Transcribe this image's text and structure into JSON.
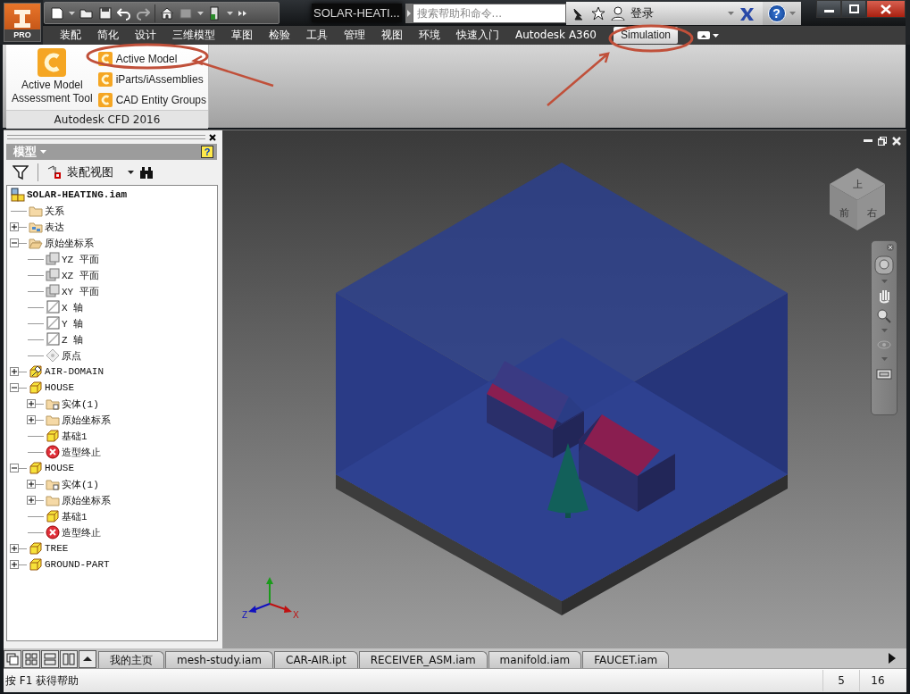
{
  "window": {
    "title": "SOLAR-HEATI...",
    "app_badge": "PRO"
  },
  "search": {
    "placeholder": "搜索帮助和命令..."
  },
  "account": {
    "sign_in": "登录",
    "help_label": "?"
  },
  "ribbon_tabs": [
    {
      "label": "装配",
      "selected": false
    },
    {
      "label": "简化",
      "selected": false
    },
    {
      "label": "设计",
      "selected": false
    },
    {
      "label": "三维模型",
      "selected": false
    },
    {
      "label": "草图",
      "selected": false
    },
    {
      "label": "检验",
      "selected": false
    },
    {
      "label": "工具",
      "selected": false
    },
    {
      "label": "管理",
      "selected": false
    },
    {
      "label": "视图",
      "selected": false
    },
    {
      "label": "环境",
      "selected": false
    },
    {
      "label": "快速入门",
      "selected": false
    },
    {
      "label": "Autodesk A360",
      "selected": false
    },
    {
      "label": "Simulation",
      "selected": true
    }
  ],
  "ribbon_panel": {
    "title": "Autodesk CFD 2016",
    "large_button": "Active Model Assessment Tool",
    "small_buttons": [
      "Active Model",
      "iParts/iAssemblies",
      "CAD Entity Groups"
    ]
  },
  "browser": {
    "title": "模型",
    "help_label": "?",
    "view_label": "装配视图",
    "tree": [
      {
        "label": "SOLAR-HEATING.iam",
        "kind": "assembly",
        "children": [
          {
            "label": "关系",
            "kind": "folder"
          },
          {
            "label": "表达",
            "kind": "rep-folder",
            "expanded": false
          },
          {
            "label": "原始坐标系",
            "kind": "open-folder",
            "expanded": true,
            "children": [
              {
                "label": "YZ 平面",
                "kind": "plane"
              },
              {
                "label": "XZ 平面",
                "kind": "plane"
              },
              {
                "label": "XY 平面",
                "kind": "plane"
              },
              {
                "label": "X 轴",
                "kind": "axis"
              },
              {
                "label": "Y 轴",
                "kind": "axis"
              },
              {
                "label": "Z 轴",
                "kind": "axis"
              },
              {
                "label": "原点",
                "kind": "point"
              }
            ]
          },
          {
            "label": "AIR-DOMAIN",
            "kind": "pinned-part",
            "expanded": false
          },
          {
            "label": "HOUSE",
            "kind": "part",
            "expanded": true,
            "children": [
              {
                "label": "实体(1)",
                "kind": "solid-folder",
                "expanded": false
              },
              {
                "label": "原始坐标系",
                "kind": "folder",
                "expanded": false
              },
              {
                "label": "基础1",
                "kind": "part"
              },
              {
                "label": "造型终止",
                "kind": "end"
              }
            ]
          },
          {
            "label": "HOUSE",
            "kind": "part",
            "expanded": true,
            "children": [
              {
                "label": "实体(1)",
                "kind": "solid-folder",
                "expanded": false
              },
              {
                "label": "原始坐标系",
                "kind": "folder",
                "expanded": false
              },
              {
                "label": "基础1",
                "kind": "part"
              },
              {
                "label": "造型终止",
                "kind": "end"
              }
            ]
          },
          {
            "label": "TREE",
            "kind": "part",
            "expanded": false
          },
          {
            "label": "GROUND-PART",
            "kind": "part",
            "expanded": false
          }
        ]
      }
    ]
  },
  "viewport": {
    "view_cube_faces": [
      "上",
      "前",
      "右"
    ],
    "axis_labels": [
      "Z",
      "X"
    ]
  },
  "document_tabs": [
    "我的主页",
    "mesh-study.iam",
    "CAR-AIR.ipt",
    "RECEIVER_ASM.iam",
    "manifold.iam",
    "FAUCET.iam"
  ],
  "status_bar": {
    "message": "按 F1 获得帮助",
    "fields": [
      "5",
      "16"
    ]
  }
}
